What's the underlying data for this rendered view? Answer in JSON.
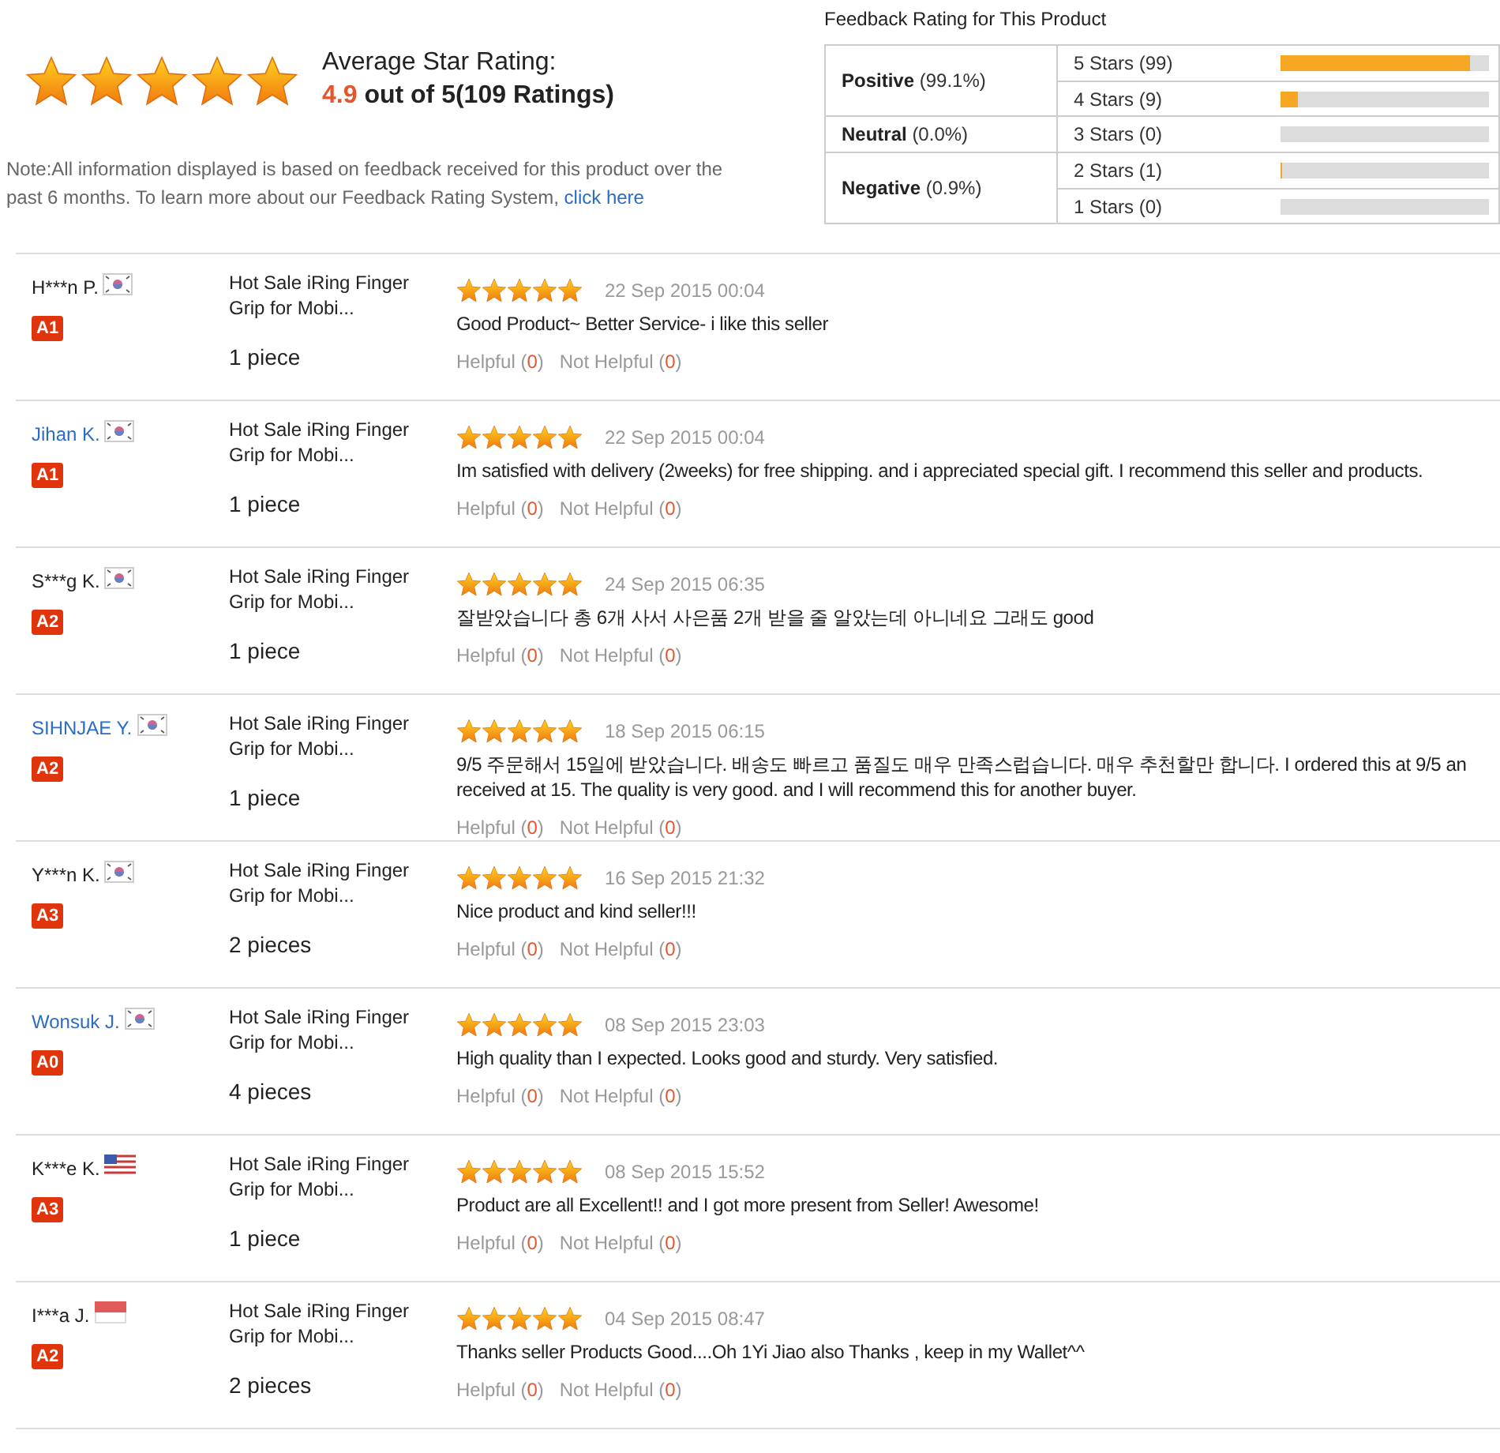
{
  "summary": {
    "stars": 5,
    "heading": "Average Star Rating:",
    "score": "4.9",
    "score_rest": "out of 5(109 Ratings)",
    "note": "Note:All information displayed is based on feedback received for this product over the past 6 months. To learn more about our Feedback Rating System,",
    "link": "click here"
  },
  "feedback": {
    "title": "Feedback Rating for This Product",
    "groups": [
      {
        "label": "Positive",
        "share": "(99.1%)",
        "rows": [
          {
            "label": "5 Stars (99)",
            "level": 0.91
          },
          {
            "label": "4 Stars (9)",
            "level": 0.08
          }
        ]
      },
      {
        "label": "Neutral",
        "share": "(0.0%)",
        "rows": [
          {
            "label": "3 Stars (0)",
            "level": 0
          }
        ]
      },
      {
        "label": "Negative",
        "share": "(0.9%)",
        "rows": [
          {
            "label": "2 Stars (1)",
            "level": 0.01
          },
          {
            "label": "1 Stars (0)",
            "level": 0
          }
        ]
      }
    ]
  },
  "reviews": [
    {
      "name": "H***n P.",
      "linked": false,
      "kind": "kr",
      "badge": "A1",
      "product": "Hot Sale iRing Finger Grip for Mobi...",
      "quantity": "1 piece",
      "stars": 5,
      "date": "22 Sep 2015 00:04",
      "comment": [
        "Good Product~ Better Service- i like this seller"
      ],
      "helpful": [
        "Helpful (",
        "0",
        ")"
      ],
      "not_helpful": [
        "Not Helpful (",
        "0",
        ")"
      ]
    },
    {
      "name": "Jihan K.",
      "linked": true,
      "kind": "kr",
      "badge": "A1",
      "product": "Hot Sale iRing Finger Grip for Mobi...",
      "quantity": "1 piece",
      "stars": 5,
      "date": "22 Sep 2015 00:04",
      "comment": [
        "Im satisfied with delivery (2weeks) for free shipping. and i appreciated special gift. I recommend this seller and products."
      ],
      "helpful": [
        "Helpful (",
        "0",
        ")"
      ],
      "not_helpful": [
        "Not Helpful (",
        "0",
        ")"
      ]
    },
    {
      "name": "S***g K.",
      "linked": false,
      "kind": "kr",
      "badge": "A2",
      "product": "Hot Sale iRing Finger Grip for Mobi...",
      "quantity": "1 piece",
      "stars": 5,
      "date": "24 Sep 2015 06:35",
      "comment": [
        "잘받았습니다 총 6개 사서 사은품 2개 받을 줄 알았는데 아니네요 그래도 good"
      ],
      "helpful": [
        "Helpful (",
        "0",
        ")"
      ],
      "not_helpful": [
        "Not Helpful (",
        "0",
        ")"
      ]
    },
    {
      "name": "SIHNJAE Y.",
      "linked": true,
      "kind": "kr",
      "badge": "A2",
      "product": "Hot Sale iRing Finger Grip for Mobi...",
      "quantity": "1 piece",
      "stars": 5,
      "date": "18 Sep 2015 06:15",
      "comment": [
        "9/5 주문해서 15일에 받았습니다. 배송도 빠르고 품질도 매우 만족스럽습니다. 매우 추천할만 합니다. I ordered this at 9/5 an",
        "received at 15. The quality is very good. and I will recommend this for another buyer."
      ],
      "helpful": [
        "Helpful (",
        "0",
        ")"
      ],
      "not_helpful": [
        "Not Helpful (",
        "0",
        ")"
      ]
    },
    {
      "name": "Y***n K.",
      "linked": false,
      "kind": "kr",
      "badge": "A3",
      "product": "Hot Sale iRing Finger Grip for Mobi...",
      "quantity": "2 pieces",
      "stars": 5,
      "date": "16 Sep 2015 21:32",
      "comment": [
        "Nice product and kind seller!!!"
      ],
      "helpful": [
        "Helpful (",
        "0",
        ")"
      ],
      "not_helpful": [
        "Not Helpful (",
        "0",
        ")"
      ]
    },
    {
      "name": "Wonsuk J.",
      "linked": true,
      "kind": "kr",
      "badge": "A0",
      "product": "Hot Sale iRing Finger Grip for Mobi...",
      "quantity": "4 pieces",
      "stars": 5,
      "date": "08 Sep 2015 23:03",
      "comment": [
        "High quality than I expected. Looks good and sturdy. Very satisfied."
      ],
      "helpful": [
        "Helpful (",
        "0",
        ")"
      ],
      "not_helpful": [
        "Not Helpful (",
        "0",
        ")"
      ]
    },
    {
      "name": "K***e K.",
      "linked": false,
      "kind": "us",
      "badge": "A3",
      "product": "Hot Sale iRing Finger Grip for Mobi...",
      "quantity": "1 piece",
      "stars": 5,
      "date": "08 Sep 2015 15:52",
      "comment": [
        "Product are all Excellent!! and I got more present from Seller! Awesome!"
      ],
      "helpful": [
        "Helpful (",
        "0",
        ")"
      ],
      "not_helpful": [
        "Not Helpful (",
        "0",
        ")"
      ]
    },
    {
      "name": "I***a J.",
      "linked": false,
      "kind": "id",
      "badge": "A2",
      "product": "Hot Sale iRing Finger Grip for Mobi...",
      "quantity": "2 pieces",
      "stars": 5,
      "date": "04 Sep 2015 08:47",
      "comment": [
        "Thanks seller Products Good....Oh 1Yi Jiao also Thanks , keep in my Wallet^^"
      ],
      "helpful": [
        "Helpful (",
        "0",
        ")"
      ],
      "not_helpful": [
        "Not Helpful (",
        "0",
        ")"
      ]
    }
  ]
}
